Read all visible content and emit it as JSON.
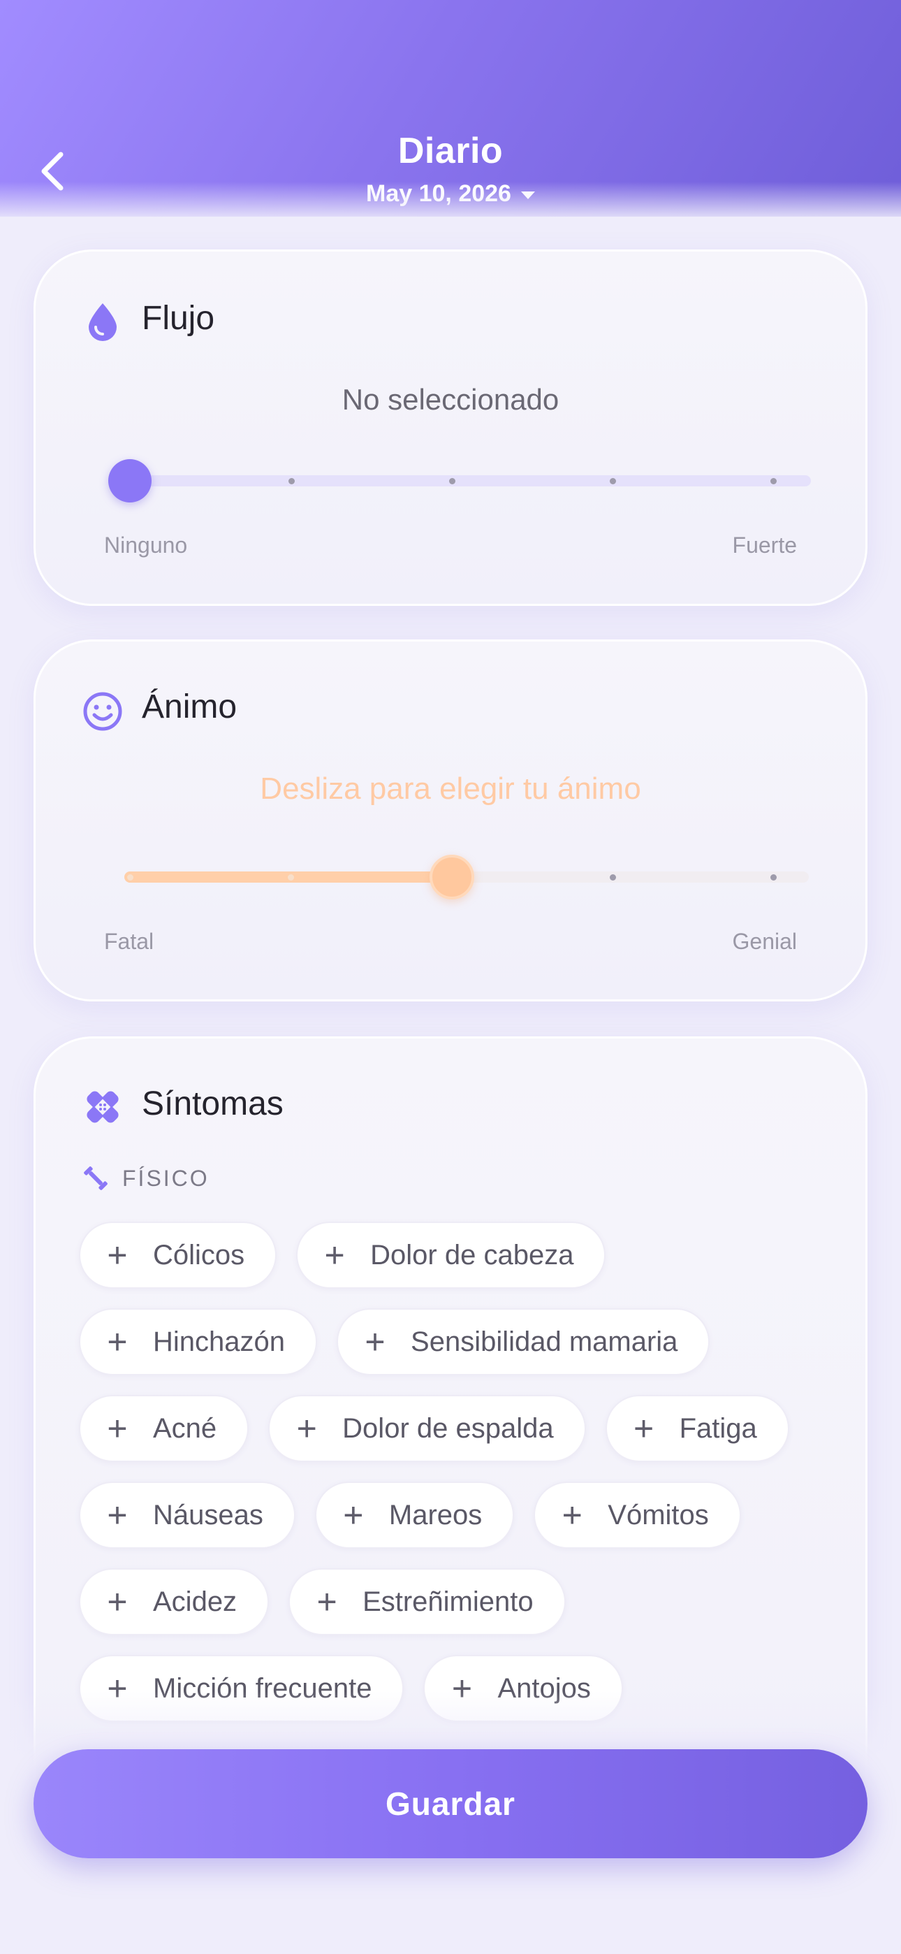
{
  "header": {
    "title": "Diario",
    "date": "May 10, 2026"
  },
  "flow": {
    "title": "Flujo",
    "status": "No seleccionado",
    "min_label": "Ninguno",
    "max_label": "Fuerte",
    "value": 0,
    "steps": 5
  },
  "mood": {
    "title": "Ánimo",
    "hint": "Desliza para elegir tu ánimo",
    "min_label": "Fatal",
    "max_label": "Genial",
    "value": 0.5,
    "steps": 5
  },
  "symptoms": {
    "title": "Síntomas",
    "section_label": "FÍSICO",
    "chips": [
      {
        "label": "Cólicos"
      },
      {
        "label": "Dolor de cabeza"
      },
      {
        "label": "Hinchazón"
      },
      {
        "label": "Sensibilidad mamaria"
      },
      {
        "label": "Acné"
      },
      {
        "label": "Dolor de espalda"
      },
      {
        "label": "Fatiga"
      },
      {
        "label": "Náuseas"
      },
      {
        "label": "Mareos"
      },
      {
        "label": "Vómitos"
      },
      {
        "label": "Acidez"
      },
      {
        "label": "Estreñimiento"
      },
      {
        "label": "Micción frecuente"
      },
      {
        "label": "Antojos"
      }
    ]
  },
  "save_label": "Guardar",
  "colors": {
    "accent": "#8b77f6",
    "mood_accent": "#ffcfa9",
    "track_flow": "#e4e0fb"
  }
}
